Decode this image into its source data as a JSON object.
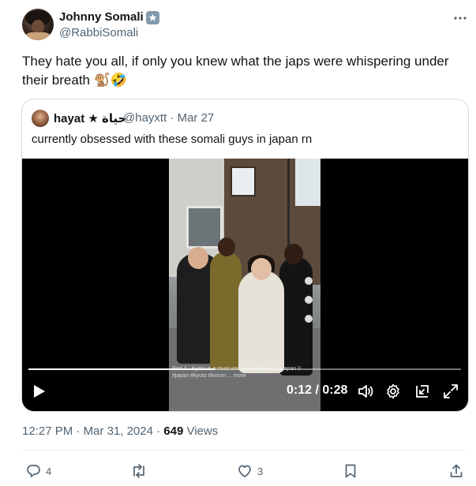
{
  "author": {
    "name": "Johnny Somali",
    "handle": "@RabbiSomali"
  },
  "tweet": {
    "text": "They hate you all, if only you knew what the japs were whispering under their breath 🐒🤣"
  },
  "quoted": {
    "name": "hayat ★ حياة",
    "handle_date": "@hayxtt · Mar 27",
    "text": "currently obsessed with these somali guys in japan rn",
    "video": {
      "current_time": "0:12",
      "separator": " / ",
      "duration": "0:28",
      "progress_fraction": 0.43,
      "caption": "Part 4 : Kyoto is a must visit if you ever go to japan !! #japan #kyoto #kimon ... more"
    }
  },
  "meta": {
    "time": "12:27 PM",
    "dot1": " · ",
    "date": "Mar 31, 2024",
    "dot2": " · ",
    "views_count": "649",
    "views_label": " Views"
  },
  "actions": {
    "replies": "4",
    "retweets": "",
    "likes": "3"
  },
  "colors": {
    "text_primary": "#0f1419",
    "text_secondary": "#536471",
    "border": "#cfd9de",
    "badge": "#829aab"
  }
}
